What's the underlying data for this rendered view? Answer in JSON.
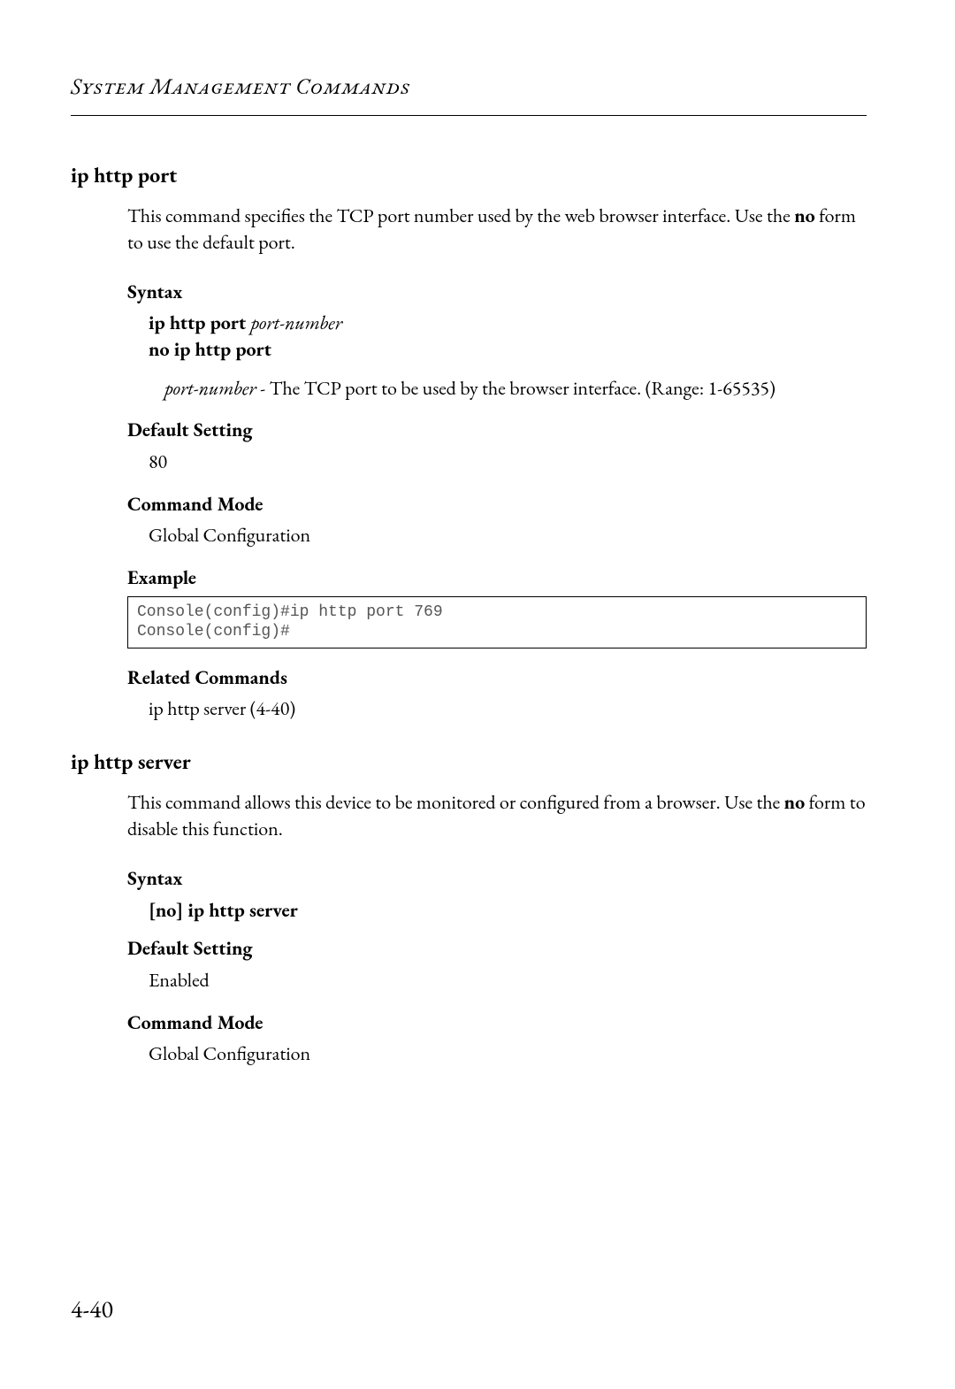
{
  "running_head": "System Management Commands",
  "page_number": "4-40",
  "cmd1": {
    "title": "ip http port",
    "intro_a": "This command specifies the TCP port number used by the web browser interface. Use the ",
    "intro_no": "no",
    "intro_b": " form to use the default port.",
    "syntax_head": "Syntax",
    "syntax_l1_bold": "ip http port ",
    "syntax_l1_ital": "port-number",
    "syntax_l2": "no ip http port",
    "param_ital": "port-number",
    "param_rest": " - The TCP port to be used by the browser interface. (Range: 1-65535)",
    "default_head": "Default Setting",
    "default_val": "80",
    "mode_head": "Command Mode",
    "mode_val": "Global Configuration",
    "example_head": "Example",
    "example_code": "Console(config)#ip http port 769\nConsole(config)#",
    "related_head": "Related Commands",
    "related_val": "ip http server (4-40)"
  },
  "cmd2": {
    "title": "ip http server",
    "intro_a": "This command allows this device to be monitored or configured from a browser. Use the ",
    "intro_no": "no",
    "intro_b": " form to disable this function.",
    "syntax_head": "Syntax",
    "syntax_line_a": "[",
    "syntax_line_b": "no",
    "syntax_line_c": "] ",
    "syntax_line_d": "ip http server",
    "default_head": "Default Setting",
    "default_val": "Enabled",
    "mode_head": "Command Mode",
    "mode_val": "Global Configuration"
  }
}
